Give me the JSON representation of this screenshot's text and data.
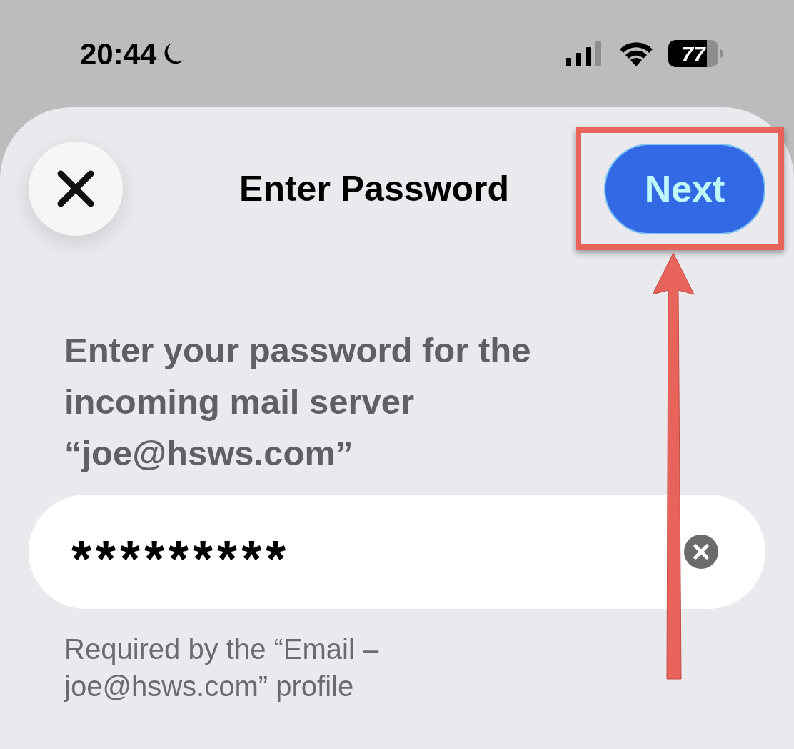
{
  "status_bar": {
    "time": "20:44",
    "battery": "77"
  },
  "header": {
    "title": "Enter Password",
    "next_button": "Next"
  },
  "prompt": "Enter your password for the incoming mail server “joe@hsws.com”",
  "password_field": {
    "value": "*********"
  },
  "footnote": "Required by the “Email – joe@hsws.com” profile"
}
